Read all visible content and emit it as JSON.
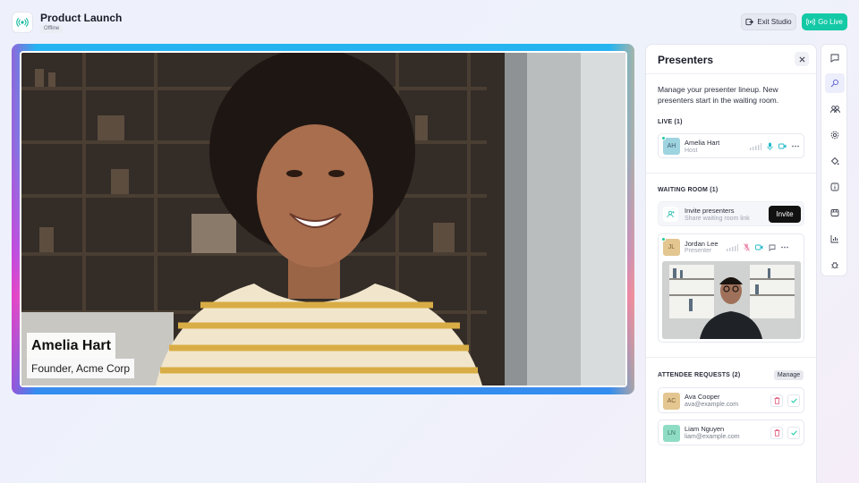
{
  "header": {
    "title": "Product Launch",
    "status": "Offline",
    "exit_label": "Exit Studio",
    "live_label": "Go Live",
    "accent": "#14c9a6"
  },
  "stage": {
    "presenter_name": "Amelia Hart",
    "presenter_title": "Founder, Acme Corp"
  },
  "panel": {
    "title": "Presenters",
    "description": "Manage your presenter lineup. New presenters start in the waiting room.",
    "live_label": "LIVE (1)",
    "live": [
      {
        "initials": "AH",
        "name": "Amelia Hart",
        "role": "Host",
        "avatar_color": "#9ed3e0"
      }
    ],
    "waiting_label": "WAITING ROOM (1)",
    "invite": {
      "title": "Invite presenters",
      "subtitle": "Share waiting room link",
      "button": "Invite"
    },
    "waiting": [
      {
        "initials": "JL",
        "name": "Jordan Lee",
        "role": "Presenter",
        "avatar_color": "#e3c690"
      }
    ],
    "requests_label": "ATTENDEE REQUESTS (2)",
    "manage_label": "Manage",
    "requests": [
      {
        "initials": "AC",
        "name": "Ava Cooper",
        "email": "ava@example.com",
        "avatar_color": "#e3c690"
      },
      {
        "initials": "LN",
        "name": "Liam Nguyen",
        "email": "liam@example.com",
        "avatar_color": "#8fdcc5"
      }
    ]
  },
  "rail": {
    "icons": [
      "chat-icon",
      "presenters-icon",
      "people-icon",
      "settings-icon",
      "paint-icon",
      "info-icon",
      "media-icon",
      "chart-icon",
      "bug-icon"
    ],
    "active": "presenters-icon"
  }
}
